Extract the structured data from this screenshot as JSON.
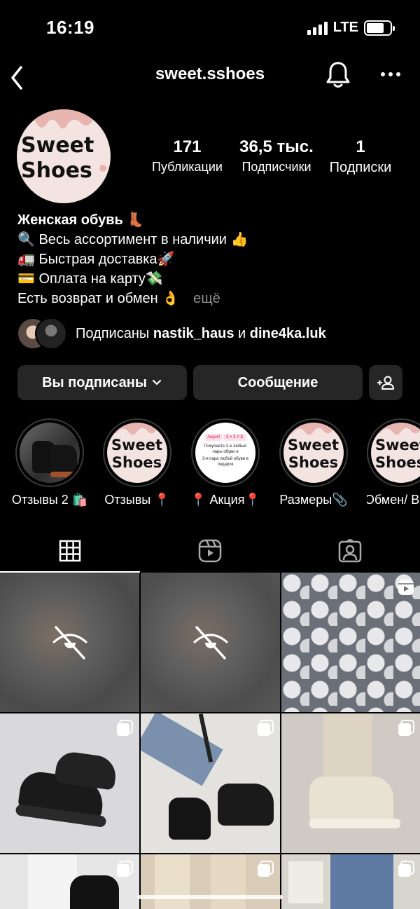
{
  "status_bar": {
    "time": "16:19",
    "network": "LTE",
    "battery_level": 0.75
  },
  "header": {
    "username": "sweet.sshoes"
  },
  "profile": {
    "avatar_text_line1": "Sweet",
    "avatar_text_line2": "Shoes",
    "stats": [
      {
        "value": "171",
        "label": "Публикации"
      },
      {
        "value": "36,5 тыс.",
        "label": "Подписчики"
      },
      {
        "value": "1",
        "label": "Подписки"
      }
    ],
    "bio": {
      "name": "Женская обувь 👢",
      "lines": [
        "🔍 Весь ассортимент в наличии 👍",
        "🚛 Быстрая доставка🚀",
        "💳 Оплата на карту💸",
        "Есть возврат и обмен 👌"
      ],
      "more": "ещё"
    },
    "followed_by": {
      "prefix": "Подписаны",
      "user1": "nastik_haus",
      "conj": "и",
      "user2": "dine4ka.luk"
    }
  },
  "buttons": {
    "following": "Вы подписаны",
    "message": "Сообщение"
  },
  "highlights": [
    {
      "label": "Отзывы 2 🛍️"
    },
    {
      "label": "Отзывы 📍",
      "text1": "Sweet",
      "text2": "Shoes"
    },
    {
      "label": "📍 Акция📍",
      "story_title": "Акция!",
      "story_formula": "1 + 1 = 3",
      "story_line1": "Покупаете 2-е любые пары обуви и",
      "story_line2": "3-я пара любой обуви в подарок"
    },
    {
      "label": "Размеры📎",
      "text1": "Sweet",
      "text2": "Shoes"
    },
    {
      "label": "Обмен/ В",
      "text1": "Sweet",
      "text2": "Shoes"
    }
  ],
  "tabs": [
    {
      "name": "grid-icon",
      "active": true
    },
    {
      "name": "reels-icon",
      "active": false
    },
    {
      "name": "tagged-icon",
      "active": false
    }
  ]
}
